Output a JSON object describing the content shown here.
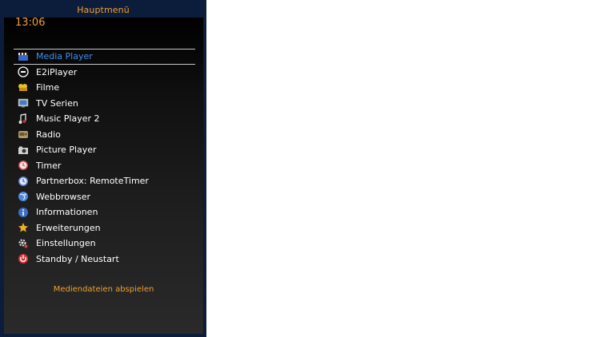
{
  "window": {
    "title": "Hauptmenü"
  },
  "clock": "13:06",
  "menu": {
    "selected_index": 0,
    "items": [
      {
        "label": "Media Player",
        "icon": "clapperboard-icon"
      },
      {
        "label": "E2iPlayer",
        "icon": "e2i-logo-icon"
      },
      {
        "label": "Filme",
        "icon": "film-reel-icon"
      },
      {
        "label": "TV Serien",
        "icon": "tv-icon"
      },
      {
        "label": "Music Player 2",
        "icon": "music-note-icon"
      },
      {
        "label": "Radio",
        "icon": "radio-icon"
      },
      {
        "label": "Picture Player",
        "icon": "camera-icon"
      },
      {
        "label": "Timer",
        "icon": "clock-red-icon"
      },
      {
        "label": "Partnerbox: RemoteTimer",
        "icon": "clock-blue-icon"
      },
      {
        "label": "Webbrowser",
        "icon": "globe-icon"
      },
      {
        "label": "Informationen",
        "icon": "info-icon"
      },
      {
        "label": "Erweiterungen",
        "icon": "star-icon"
      },
      {
        "label": "Einstellungen",
        "icon": "gear-icon"
      },
      {
        "label": "Standby / Neustart",
        "icon": "power-icon"
      }
    ]
  },
  "description": "Mediendateien abspielen",
  "colors": {
    "accent": "#f0a030",
    "selected_text": "#3d8ff0",
    "text": "#ffffff",
    "frame_border": "#0b1d3a"
  }
}
